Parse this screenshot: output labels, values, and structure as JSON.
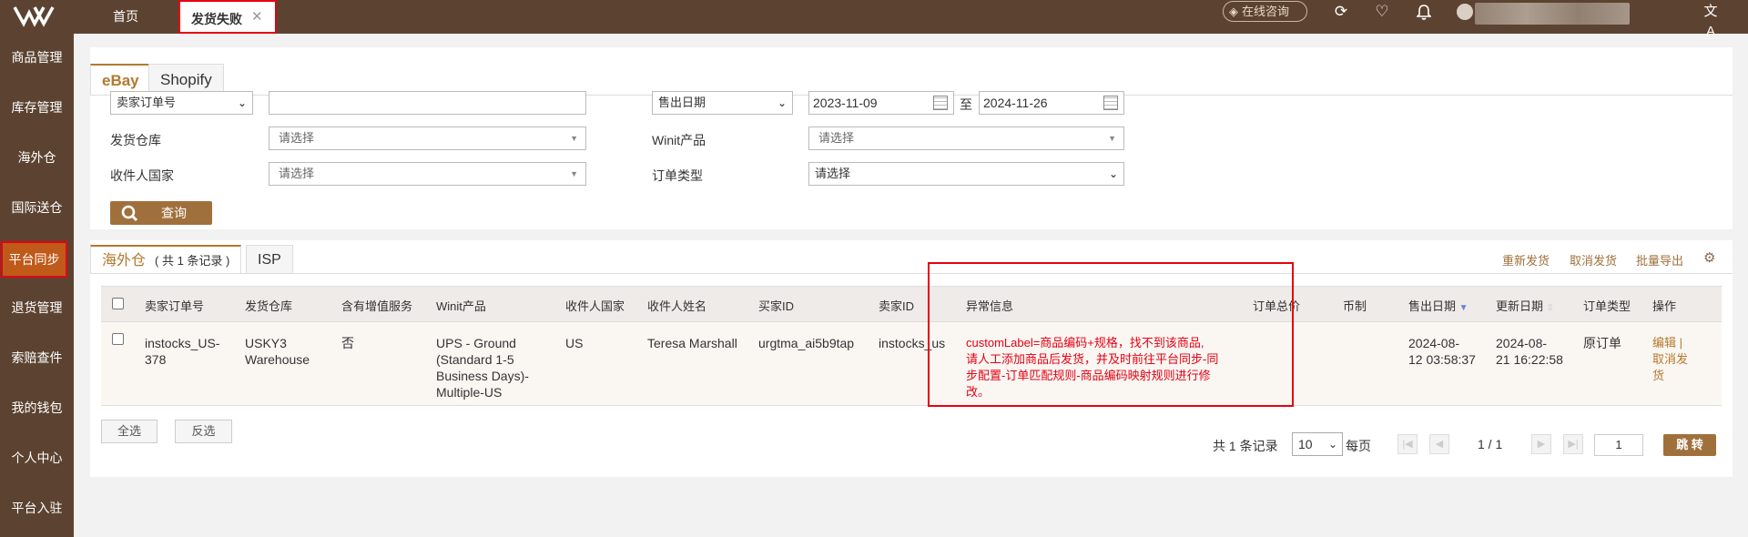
{
  "topbar": {
    "tabs": [
      {
        "label": "首页"
      },
      {
        "label": "发货失败",
        "close": "✕"
      }
    ],
    "consult_label": "在线咨询",
    "icons": [
      "refresh-icon",
      "heart-icon",
      "bell-icon",
      "translate-icon"
    ]
  },
  "sidebar": {
    "items": [
      {
        "label": "商品管理"
      },
      {
        "label": "库存管理"
      },
      {
        "label": "海外仓"
      },
      {
        "label": "国际送仓"
      },
      {
        "label": "平台同步",
        "active": true
      },
      {
        "label": "退货管理"
      },
      {
        "label": "索赔查件"
      },
      {
        "label": "我的钱包"
      },
      {
        "label": "个人中心"
      },
      {
        "label": "平台入驻"
      }
    ]
  },
  "platform_tabs": [
    {
      "label": "eBay",
      "active": true
    },
    {
      "label": "Shopify"
    }
  ],
  "filters": {
    "order_type_select": "卖家订单号",
    "order_no_value": "",
    "date_select": "售出日期",
    "date_from": "2023-11-09",
    "date_sep": "至",
    "date_to": "2024-11-26",
    "warehouse_label": "发货仓库",
    "warehouse_placeholder": "请选择",
    "winit_product_label": "Winit产品",
    "winit_product_placeholder": "请选择",
    "country_label": "收件人国家",
    "country_placeholder": "请选择",
    "order_kind_label": "订单类型",
    "order_kind_value": "请选择",
    "search_label": "查询"
  },
  "result_tabs": [
    {
      "label": "海外仓",
      "count": "( 共 1 条记录 )",
      "active": true
    },
    {
      "label": "ISP"
    }
  ],
  "actions": {
    "resend": "重新发货",
    "cancel": "取消发货",
    "export": "批量导出"
  },
  "table": {
    "headers": [
      "卖家订单号",
      "发货仓库",
      "含有增值服务",
      "Winit产品",
      "收件人国家",
      "收件人姓名",
      "买家ID",
      "卖家ID",
      "异常信息",
      "订单总价",
      "币制",
      "售出日期",
      "更新日期",
      "订单类型",
      "操作"
    ],
    "rows": [
      {
        "order_no": [
          "instocks_US-",
          "378"
        ],
        "warehouse": [
          "USKY3",
          "Warehouse"
        ],
        "value_added": "否",
        "winit_product": [
          "UPS - Ground",
          "(Standard 1-5",
          "Business Days)-",
          "Multiple-US"
        ],
        "country": "US",
        "recipient": "Teresa Marshall",
        "buyer_id": "urgtma_ai5b9tap",
        "seller_id": "instocks_us",
        "error": [
          "customLabel=商品编码+规格，找不到该商品,",
          "请人工添加商品后发货，并及时前往平台同步-同",
          "步配置-订单匹配规则-商品编码映射规则进行修",
          "改。"
        ],
        "total": "",
        "currency": "",
        "sold_date": [
          "2024-08-",
          "12 03:58:37"
        ],
        "update_date": [
          "2024-08-",
          "21 16:22:58"
        ],
        "order_type": "原订单",
        "ops": [
          "编辑 |",
          "取消发",
          "货"
        ]
      }
    ]
  },
  "bottom": {
    "select_all": "全选",
    "invert": "反选"
  },
  "pager": {
    "total": "共 1 条记录",
    "page_size": "10",
    "per_page": "每页",
    "page_info": "1 / 1",
    "jump_value": "1",
    "jump_label": "跳 转"
  }
}
